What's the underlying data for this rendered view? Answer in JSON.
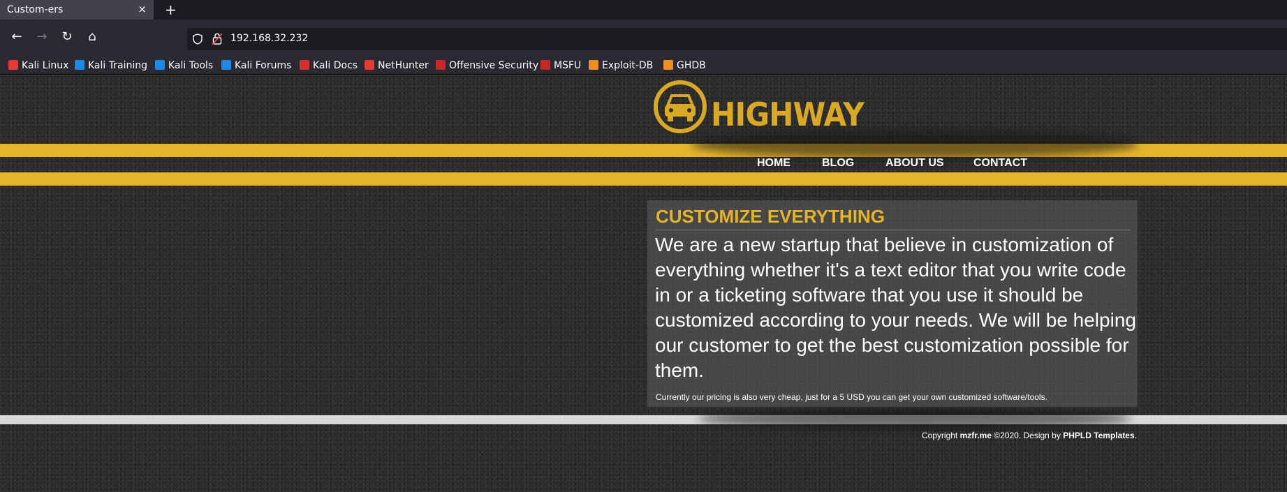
{
  "browser": {
    "tab_title": "Custom-ers",
    "tab_close": "×",
    "new_tab": "+",
    "url": "192.168.32.232",
    "nav": {
      "back": "←",
      "forward": "→",
      "reload": "↻",
      "home": "⌂"
    },
    "bookmarks": [
      {
        "label": "Kali Linux",
        "icon": "kali-icon",
        "color": "#e53935"
      },
      {
        "label": "Kali Training",
        "icon": "kali-training-icon",
        "color": "#1e88e5"
      },
      {
        "label": "Kali Tools",
        "icon": "kali-tools-icon",
        "color": "#1e88e5"
      },
      {
        "label": "Kali Forums",
        "icon": "kali-forums-icon",
        "color": "#1e88e5"
      },
      {
        "label": "Kali Docs",
        "icon": "kali-docs-icon",
        "color": "#d32f2f"
      },
      {
        "label": "NetHunter",
        "icon": "nethunter-icon",
        "color": "#e53935"
      },
      {
        "label": "Offensive Security",
        "icon": "offsec-icon",
        "color": "#c62828"
      },
      {
        "label": "MSFU",
        "icon": "msfu-icon",
        "color": "#c62828"
      },
      {
        "label": "Exploit-DB",
        "icon": "exploitdb-icon",
        "color": "#ef8c22"
      },
      {
        "label": "GHDB",
        "icon": "ghdb-icon",
        "color": "#ef8c22"
      }
    ]
  },
  "site": {
    "logo_text": "HIGHWAY",
    "menu": [
      "HOME",
      "BLOG",
      "ABOUT US",
      "CONTACT"
    ],
    "heading": "CUSTOMIZE EVERYTHING",
    "body": "We are a new startup that believe in customization of everything whether it's a text editor that you write code in or a ticketing software that you use it should be customized according to your needs. We will be helping our customer to get the best customization possible for them.",
    "note": "Currently our pricing is also very cheap, just for a 5 USD you can get your own customized software/tools.",
    "footer": {
      "prefix": "Copyright ",
      "owner": "mzfr.me",
      "middle": " ©2020. Design by ",
      "designer": "PHPLD Templates",
      "suffix": "."
    },
    "colors": {
      "accent": "#e5b42b",
      "asphalt": "#2c2c2c",
      "text": "#ffffff"
    }
  }
}
